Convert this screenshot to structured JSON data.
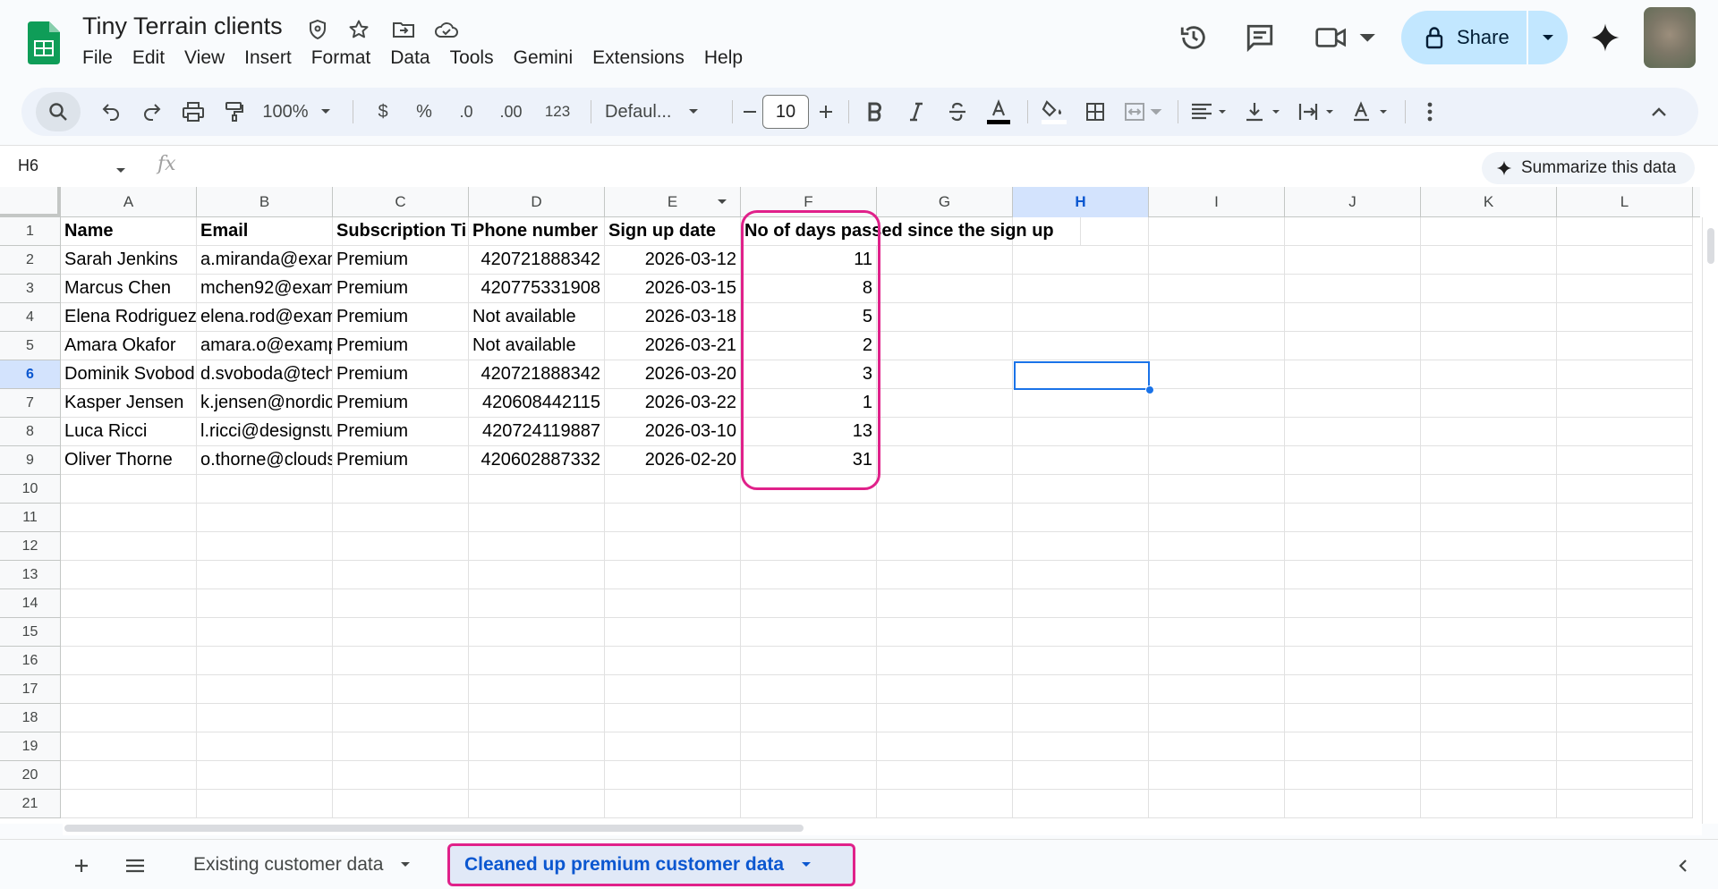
{
  "document": {
    "title": "Tiny Terrain clients"
  },
  "menu": [
    "File",
    "Edit",
    "View",
    "Insert",
    "Format",
    "Data",
    "Tools",
    "Gemini",
    "Extensions",
    "Help"
  ],
  "header": {
    "share_label": "Share"
  },
  "toolbar": {
    "zoom": "100%",
    "currency": "$",
    "percent": "%",
    "decrease_decimal": ".0",
    "increase_decimal": ".00",
    "number_format": "123",
    "font_family": "Defaul...",
    "font_size": "10"
  },
  "formula_bar": {
    "cell_ref": "H6",
    "fx_label": "fx",
    "summarize_label": "Summarize this data"
  },
  "grid": {
    "columns": [
      "A",
      "B",
      "C",
      "D",
      "E",
      "F",
      "G",
      "H",
      "I",
      "J",
      "K",
      "L"
    ],
    "selected_column": "H",
    "selected_row": 6,
    "row_numbers": [
      1,
      2,
      3,
      4,
      5,
      6,
      7,
      8,
      9,
      10,
      11,
      12,
      13,
      14,
      15,
      16,
      17,
      18,
      19,
      20,
      21
    ],
    "header_row": [
      "Name",
      "Email",
      "Subscription Ti",
      "Phone number",
      "Sign up date",
      "No of days passed since the sign up"
    ],
    "rows": [
      [
        "Sarah Jenkins",
        "a.miranda@exam",
        "Premium",
        "420721888342",
        "2026-03-12",
        "11"
      ],
      [
        "Marcus Chen",
        "mchen92@exam",
        "Premium",
        "420775331908",
        "2026-03-15",
        "8"
      ],
      [
        "Elena Rodriguez",
        "elena.rod@exam",
        "Premium",
        "Not available",
        "2026-03-18",
        "5"
      ],
      [
        "Amara Okafor",
        "amara.o@examp",
        "Premium",
        "Not available",
        "2026-03-21",
        "2"
      ],
      [
        "Dominik Svobod",
        "d.svoboda@tech",
        "Premium",
        "420721888342",
        "2026-03-20",
        "3"
      ],
      [
        "Kasper Jensen",
        "k.jensen@nordic",
        "Premium",
        "420608442115",
        "2026-03-22",
        "1"
      ],
      [
        "Luca Ricci",
        "l.ricci@designstu",
        "Premium",
        "420724119887",
        "2026-03-10",
        "13"
      ],
      [
        "Oliver Thorne",
        "o.thorne@clouds",
        "Premium",
        "420602887332",
        "2026-02-20",
        "31"
      ]
    ]
  },
  "sheets": {
    "tabs": [
      "Existing customer data",
      "Cleaned up premium customer data"
    ],
    "active": "Cleaned up premium customer data"
  },
  "colors": {
    "accent": "#0b57d0",
    "highlight": "#e0218a",
    "share_bg": "#c2e7ff",
    "sheets_green": "#0f9d58"
  }
}
